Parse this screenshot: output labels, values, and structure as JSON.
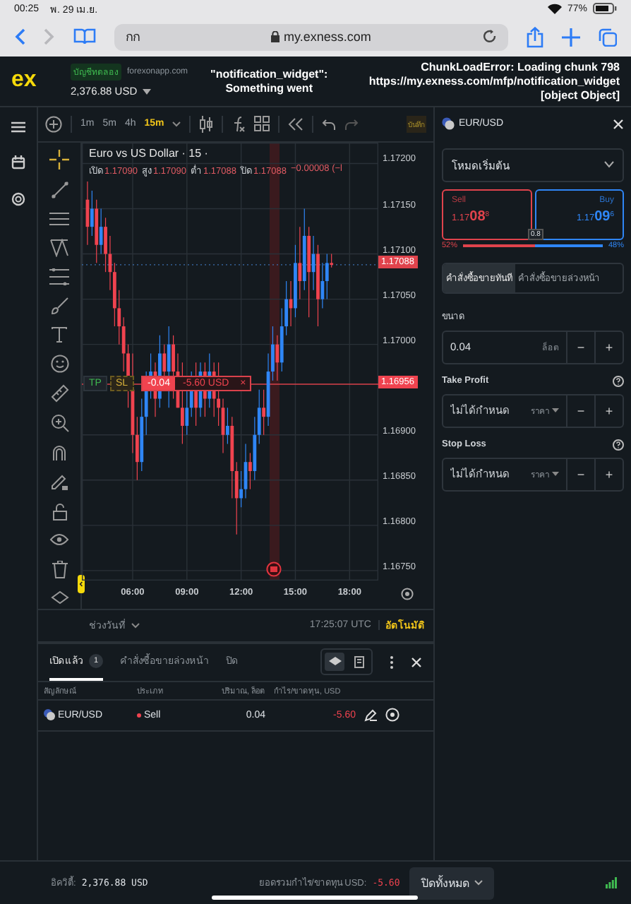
{
  "status_bar": {
    "time": "00:25",
    "date": "พ. 29 เม.ย.",
    "battery": "77%"
  },
  "browser": {
    "tab_text": "กก",
    "url": "my.exness.com"
  },
  "header": {
    "logo": "ex",
    "account_type": "บัญชีทดลอง",
    "site": "forexonapp.com",
    "balance": "2,376.88 USD",
    "error_left": [
      "\"notification_widget\":",
      "Something went"
    ],
    "error_right": [
      "ChunkLoadError: Loading chunk 798",
      "https://my.exness.com/mfp/notification_widget",
      "[object Object]"
    ]
  },
  "toolbar": {
    "timeframes": [
      {
        "label": "1m",
        "selected": false
      },
      {
        "label": "5m",
        "selected": false
      },
      {
        "label": "4h",
        "selected": false
      },
      {
        "label": "15m",
        "selected": true
      }
    ],
    "save": "บันทึก"
  },
  "chart": {
    "title": "Euro vs US Dollar · 15 ·",
    "ohlc": [
      {
        "label": "เปิด",
        "value": "1.17090"
      },
      {
        "label": "สูง",
        "value": "1.17090"
      },
      {
        "label": "ต่ำ",
        "value": "1.17088"
      },
      {
        "label": "ปิด",
        "value": "1.17088"
      }
    ],
    "change": "−0.00008 (−l",
    "chart_data": {
      "type": "candlestick",
      "x": [
        3.5,
        3.75,
        4,
        4.25,
        4.5,
        4.75,
        5,
        5.25,
        5.5,
        5.75,
        6,
        6.25,
        6.5,
        6.75,
        7,
        7.25,
        7.5,
        7.75,
        8,
        8.25,
        8.5,
        8.75,
        9,
        9.25,
        9.5,
        9.75,
        10,
        10.25,
        10.5,
        10.75,
        11,
        11.25,
        11.5,
        11.75,
        12,
        12.25,
        12.5,
        12.75,
        13,
        13.25,
        13.5,
        13.75,
        14,
        14.25,
        14.5,
        14.75,
        15,
        15.25,
        15.5,
        15.75,
        16,
        16.25,
        16.5,
        16.75,
        17
      ],
      "ohlc": [
        [
          1.1716,
          1.1718,
          1.1711,
          1.1713
        ],
        [
          1.1713,
          1.1717,
          1.1712,
          1.1715
        ],
        [
          1.1715,
          1.1716,
          1.1709,
          1.1711
        ],
        [
          1.1711,
          1.1715,
          1.171,
          1.1713
        ],
        [
          1.1713,
          1.1714,
          1.1708,
          1.171
        ],
        [
          1.171,
          1.1712,
          1.1706,
          1.1708
        ],
        [
          1.1708,
          1.1709,
          1.1702,
          1.1704
        ],
        [
          1.1704,
          1.1706,
          1.17,
          1.1702
        ],
        [
          1.1702,
          1.1703,
          1.1697,
          1.1699
        ],
        [
          1.1699,
          1.17,
          1.1693,
          1.1695
        ],
        [
          1.1695,
          1.1699,
          1.1688,
          1.169
        ],
        [
          1.169,
          1.1692,
          1.1685,
          1.1687
        ],
        [
          1.1687,
          1.1694,
          1.1686,
          1.1692
        ],
        [
          1.1692,
          1.1697,
          1.169,
          1.1695
        ],
        [
          1.1695,
          1.1699,
          1.1694,
          1.1697
        ],
        [
          1.1697,
          1.1698,
          1.1692,
          1.1694
        ],
        [
          1.1694,
          1.1701,
          1.1693,
          1.1699
        ],
        [
          1.1699,
          1.17,
          1.1695,
          1.1697
        ],
        [
          1.1697,
          1.1702,
          1.1693,
          1.17
        ],
        [
          1.17,
          1.1701,
          1.1694,
          1.1697
        ],
        [
          1.1697,
          1.1699,
          1.1693,
          1.1693
        ],
        [
          1.1693,
          1.1698,
          1.1689,
          1.1691
        ],
        [
          1.1691,
          1.1695,
          1.169,
          1.1693
        ],
        [
          1.1693,
          1.1697,
          1.1692,
          1.1695
        ],
        [
          1.1695,
          1.1698,
          1.1691,
          1.1693
        ],
        [
          1.1693,
          1.1698,
          1.1692,
          1.1697
        ],
        [
          1.1697,
          1.1698,
          1.1692,
          1.1694
        ],
        [
          1.1694,
          1.1699,
          1.1693,
          1.1697
        ],
        [
          1.1697,
          1.1698,
          1.1692,
          1.1694
        ],
        [
          1.1694,
          1.1698,
          1.1691,
          1.1693
        ],
        [
          1.1693,
          1.1694,
          1.1688,
          1.169
        ],
        [
          1.169,
          1.1693,
          1.1689,
          1.1691
        ],
        [
          1.1691,
          1.1692,
          1.1683,
          1.1686
        ],
        [
          1.1686,
          1.1687,
          1.1679,
          1.1683
        ],
        [
          1.1683,
          1.1686,
          1.1682,
          1.1684
        ],
        [
          1.1684,
          1.1689,
          1.1683,
          1.1687
        ],
        [
          1.1687,
          1.1688,
          1.1684,
          1.1686
        ],
        [
          1.1686,
          1.1692,
          1.1685,
          1.169
        ],
        [
          1.169,
          1.1695,
          1.1689,
          1.1693
        ],
        [
          1.1693,
          1.1695,
          1.169,
          1.1692
        ],
        [
          1.1692,
          1.1699,
          1.1691,
          1.1697
        ],
        [
          1.1697,
          1.1702,
          1.1696,
          1.17
        ],
        [
          1.17,
          1.1701,
          1.1696,
          1.1698
        ],
        [
          1.1698,
          1.1704,
          1.1697,
          1.1702
        ],
        [
          1.1702,
          1.1707,
          1.1701,
          1.1705
        ],
        [
          1.1705,
          1.1707,
          1.1702,
          1.1704
        ],
        [
          1.1704,
          1.1711,
          1.1703,
          1.1709
        ],
        [
          1.1709,
          1.1713,
          1.1705,
          1.1707
        ],
        [
          1.1707,
          1.1715,
          1.1706,
          1.1712
        ],
        [
          1.1712,
          1.1713,
          1.1703,
          1.1708
        ],
        [
          1.1708,
          1.1712,
          1.1706,
          1.171
        ],
        [
          1.171,
          1.1711,
          1.1702,
          1.1705
        ],
        [
          1.1705,
          1.1709,
          1.1704,
          1.1707
        ],
        [
          1.1707,
          1.171,
          1.1705,
          1.1709
        ],
        [
          1.1709,
          1.171,
          1.17085,
          1.17088
        ]
      ],
      "grid": true,
      "xlim": [
        3.19,
        19.59
      ],
      "ylim": [
        1.16739,
        1.17223
      ],
      "xticks": [
        {
          "value": 6,
          "label": "06:00"
        },
        {
          "value": 9,
          "label": "09:00"
        },
        {
          "value": 12,
          "label": "12:00"
        },
        {
          "value": 15,
          "label": "15:00"
        },
        {
          "value": 18,
          "label": "18:00"
        }
      ],
      "yticks": [
        {
          "value": 1.172,
          "label": "1.17200"
        },
        {
          "value": 1.1715,
          "label": "1.17150"
        },
        {
          "value": 1.171,
          "label": "1.17100"
        },
        {
          "value": 1.1705,
          "label": "1.17050"
        },
        {
          "value": 1.17,
          "label": "1.17000"
        },
        {
          "value": 1.169,
          "label": "1.16900"
        },
        {
          "value": 1.1685,
          "label": "1.16850"
        },
        {
          "value": 1.168,
          "label": "1.16800"
        },
        {
          "value": 1.1675,
          "label": "1.16750"
        }
      ],
      "ref_lines": [
        {
          "axis": "y",
          "value": 1.17088,
          "label": "1.17088"
        },
        {
          "axis": "y",
          "value": 1.16956,
          "label": "1.16956"
        }
      ]
    },
    "position_line": {
      "tp": "TP",
      "sl": "SL",
      "volume": "-0.04",
      "pnl": "-5.60 USD",
      "close": "×"
    },
    "date_range": "ช่วงวันที่",
    "clock": "17:25:07 UTC",
    "auto": "อัตโนมัติ"
  },
  "positions": {
    "tabs": [
      {
        "label": "เปิดแล้ว",
        "count": "1",
        "selected": true
      },
      {
        "label": "คำสั่งซื้อขายล่วงหน้า",
        "selected": false
      },
      {
        "label": "ปิด",
        "selected": false
      }
    ],
    "view_modes": [
      {
        "selected": true
      },
      {
        "selected": false
      }
    ],
    "columns": [
      "สัญลักษณ์",
      "ประเภท",
      "ปริมาณ, ล็อต",
      "กำไร/ขาดทุน, USD"
    ],
    "rows": [
      {
        "symbol": "EUR/USD",
        "type": "Sell",
        "volume": "0.04",
        "pnl": "-5.60"
      }
    ]
  },
  "order_panel": {
    "symbol": "EUR/USD",
    "mode": "โหมดเริ่มต้น",
    "sell": {
      "label": "Sell",
      "price_main": "1.17",
      "price_big": "08",
      "price_small": "8"
    },
    "buy": {
      "label": "Buy",
      "price_main": "1.17",
      "price_big": "09",
      "price_small": "6"
    },
    "spread": "0.8",
    "sell_share": "52%",
    "buy_share": "48%",
    "level": 0.52,
    "order_types": [
      {
        "label": "คำสั่งซื้อขายทันที",
        "selected": true
      },
      {
        "label": "คำสั่งซื้อขายล่วงหน้า",
        "selected": false
      }
    ],
    "volume": {
      "label": "ขนาด",
      "value": "0.04",
      "unit": "ล็อต",
      "decrement": "−",
      "increment": "+"
    },
    "take_profit": {
      "label": "Take Profit",
      "placeholder": "ไม่ได้กำหนด",
      "unit": "ราคา",
      "decrement": "−",
      "increment": "+"
    },
    "stop_loss": {
      "label": "Stop Loss",
      "placeholder": "ไม่ได้กำหนด",
      "unit": "ราคา",
      "decrement": "−",
      "increment": "+"
    }
  },
  "footer": {
    "equity_label": "อิควิตี้:",
    "equity": "2,376.88 USD",
    "pnl_label": "ยอดรวมกำไร/ขาดทุน USD:",
    "pnl": "-5.60",
    "close_all": "ปิดทั้งหมด"
  }
}
